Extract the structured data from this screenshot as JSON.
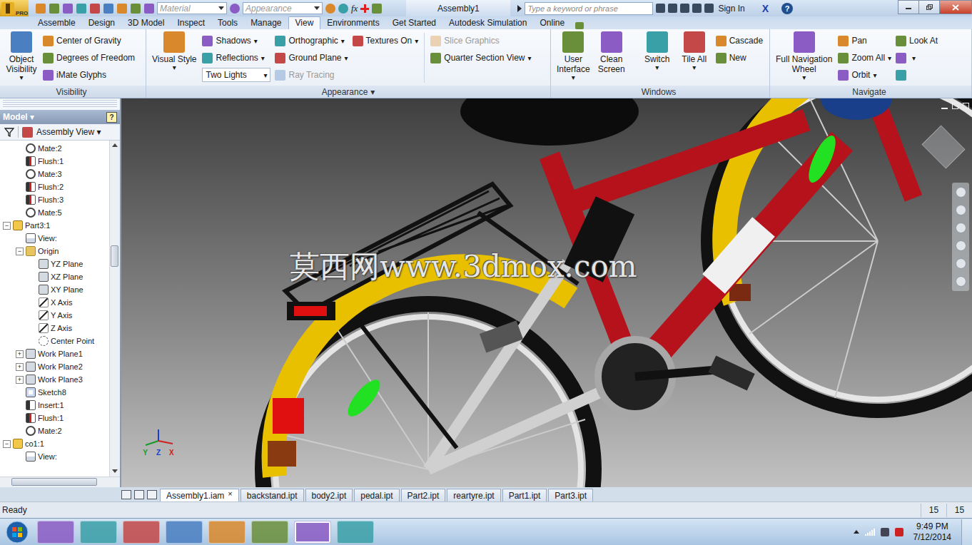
{
  "title_bar": {
    "app_badge": "PRO",
    "material": "Material",
    "appearance": "Appearance",
    "formula": "fx",
    "title": "Assembly1",
    "search_placeholder": "Type a keyword or phrase",
    "sign_in": "Sign In",
    "exchange": "X",
    "help": "?"
  },
  "menu_tabs": [
    {
      "label": "Assemble",
      "selected": false
    },
    {
      "label": "Design",
      "selected": false
    },
    {
      "label": "3D Model",
      "selected": false
    },
    {
      "label": "Inspect",
      "selected": false
    },
    {
      "label": "Tools",
      "selected": false
    },
    {
      "label": "Manage",
      "selected": false
    },
    {
      "label": "View",
      "selected": true
    },
    {
      "label": "Environments",
      "selected": false
    },
    {
      "label": "Get Started",
      "selected": false
    },
    {
      "label": "Autodesk Simulation",
      "selected": false
    },
    {
      "label": "Online",
      "selected": false
    }
  ],
  "ribbon": {
    "groups": [
      {
        "label": "Visibility",
        "arrow": "",
        "columns": [
          {
            "kind": "large",
            "items": [
              {
                "lines": [
                  "Object",
                  "Visibility"
                ],
                "arrow": "▾",
                "disabled": false
              }
            ]
          },
          {
            "kind": "stack",
            "items": [
              {
                "kind": "button",
                "label": "Center of Gravity",
                "arrow": "",
                "disabled": false
              },
              {
                "kind": "button",
                "label": "Degrees of Freedom",
                "arrow": "",
                "disabled": false
              },
              {
                "kind": "button",
                "label": "iMate Glyphs",
                "arrow": "",
                "disabled": false
              }
            ]
          }
        ]
      },
      {
        "label": "Appearance",
        "arrow": "▾",
        "columns": [
          {
            "kind": "large",
            "items": [
              {
                "lines": [
                  "Visual Style"
                ],
                "arrow": "▾",
                "disabled": false
              }
            ]
          },
          {
            "kind": "stack",
            "items": [
              {
                "kind": "button",
                "label": "Shadows",
                "arrow": "▾",
                "disabled": false
              },
              {
                "kind": "button",
                "label": "Reflections",
                "arrow": "▾",
                "disabled": false
              },
              {
                "kind": "combo",
                "label": "Two Lights",
                "arrow": "▾",
                "disabled": false
              }
            ]
          },
          {
            "kind": "stack",
            "items": [
              {
                "kind": "button",
                "label": "Orthographic",
                "arrow": "▾",
                "disabled": false
              },
              {
                "kind": "button",
                "label": "Ground Plane",
                "arrow": "▾",
                "disabled": false
              },
              {
                "kind": "button",
                "label": "Ray Tracing",
                "arrow": "",
                "disabled": true
              }
            ]
          },
          {
            "kind": "stack",
            "items": [
              {
                "kind": "button",
                "label": "Textures On",
                "arrow": "▾",
                "disabled": false
              }
            ]
          },
          {
            "kind": "divider",
            "items": []
          },
          {
            "kind": "stack",
            "items": [
              {
                "kind": "button",
                "label": "Slice Graphics",
                "arrow": "",
                "disabled": true
              },
              {
                "kind": "button",
                "label": "Quarter Section View",
                "arrow": "▾",
                "disabled": false
              }
            ]
          }
        ]
      },
      {
        "label": "Windows",
        "arrow": "",
        "columns": [
          {
            "kind": "large",
            "items": [
              {
                "lines": [
                  "User",
                  "Interface"
                ],
                "arrow": "▾",
                "disabled": false
              },
              {
                "lines": [
                  "Clean",
                  "Screen"
                ],
                "arrow": "",
                "disabled": false
              }
            ]
          },
          {
            "kind": "divider",
            "items": []
          },
          {
            "kind": "large",
            "items": [
              {
                "lines": [
                  "Switch"
                ],
                "arrow": "▾",
                "disabled": false
              },
              {
                "lines": [
                  "Tile All"
                ],
                "arrow": "▾",
                "disabled": false
              }
            ]
          },
          {
            "kind": "stack",
            "items": [
              {
                "kind": "button",
                "label": "Cascade",
                "arrow": "",
                "disabled": false
              },
              {
                "kind": "button",
                "label": "New",
                "arrow": "",
                "disabled": false
              }
            ]
          }
        ]
      },
      {
        "label": "Navigate",
        "arrow": "",
        "columns": [
          {
            "kind": "large",
            "items": [
              {
                "lines": [
                  "Full Navigation",
                  "Wheel"
                ],
                "arrow": "▾",
                "disabled": false
              }
            ]
          },
          {
            "kind": "stack",
            "items": [
              {
                "kind": "button",
                "label": "Pan",
                "arrow": "",
                "disabled": false
              },
              {
                "kind": "button",
                "label": "Zoom All",
                "arrow": "▾",
                "disabled": false
              },
              {
                "kind": "button",
                "label": "Orbit",
                "arrow": "▾",
                "disabled": false
              }
            ]
          },
          {
            "kind": "stack",
            "items": [
              {
                "kind": "button",
                "label": "Look At",
                "arrow": "",
                "disabled": false
              },
              {
                "kind": "button",
                "label": "",
                "arrow": "▾",
                "disabled": false
              },
              {
                "kind": "button",
                "label": "",
                "arrow": "",
                "disabled": false
              }
            ]
          }
        ]
      }
    ]
  },
  "browser": {
    "title": "Model",
    "title_arrow": "▾",
    "help": "?",
    "filter": "Assembly View",
    "filter_arrow": "▾",
    "toggle_glyphs": {
      "expanded": "−",
      "collapsed": "+"
    },
    "scroll": {
      "level": 0.3
    },
    "tree": [
      {
        "label": "Mate:2",
        "level": 2,
        "kind": "mate",
        "has_children": false,
        "expanded": false
      },
      {
        "label": "Flush:1",
        "level": 2,
        "kind": "flush",
        "has_children": false,
        "expanded": false
      },
      {
        "label": "Mate:3",
        "level": 2,
        "kind": "mate",
        "has_children": false,
        "expanded": false
      },
      {
        "label": "Flush:2",
        "level": 2,
        "kind": "flush",
        "has_children": false,
        "expanded": false
      },
      {
        "label": "Flush:3",
        "level": 2,
        "kind": "flush",
        "has_children": false,
        "expanded": false
      },
      {
        "label": "Mate:5",
        "level": 2,
        "kind": "mate",
        "has_children": false,
        "expanded": false
      },
      {
        "label": "Part3:1",
        "level": 1,
        "kind": "part",
        "has_children": true,
        "expanded": true
      },
      {
        "label": "View:",
        "level": 2,
        "kind": "view",
        "has_children": false,
        "expanded": false
      },
      {
        "label": "Origin",
        "level": 2,
        "kind": "folder",
        "has_children": true,
        "expanded": true
      },
      {
        "label": "YZ Plane",
        "level": 3,
        "kind": "plane",
        "has_children": false,
        "expanded": false
      },
      {
        "label": "XZ Plane",
        "level": 3,
        "kind": "plane",
        "has_children": false,
        "expanded": false
      },
      {
        "label": "XY Plane",
        "level": 3,
        "kind": "plane",
        "has_children": false,
        "expanded": false
      },
      {
        "label": "X Axis",
        "level": 3,
        "kind": "axis",
        "has_children": false,
        "expanded": false
      },
      {
        "label": "Y Axis",
        "level": 3,
        "kind": "axis",
        "has_children": false,
        "expanded": false
      },
      {
        "label": "Z Axis",
        "level": 3,
        "kind": "axis",
        "has_children": false,
        "expanded": false
      },
      {
        "label": "Center Point",
        "level": 3,
        "kind": "point",
        "has_children": false,
        "expanded": false
      },
      {
        "label": "Work Plane1",
        "level": 2,
        "kind": "plane",
        "has_children": true,
        "expanded": false
      },
      {
        "label": "Work Plane2",
        "level": 2,
        "kind": "plane",
        "has_children": true,
        "expanded": false
      },
      {
        "label": "Work Plane3",
        "level": 2,
        "kind": "plane",
        "has_children": true,
        "expanded": false
      },
      {
        "label": "Sketch8",
        "level": 2,
        "kind": "sketch",
        "has_children": false,
        "expanded": false
      },
      {
        "label": "Insert:1",
        "level": 2,
        "kind": "insert",
        "has_children": false,
        "expanded": false
      },
      {
        "label": "Flush:1",
        "level": 2,
        "kind": "flush",
        "has_children": false,
        "expanded": false
      },
      {
        "label": "Mate:2",
        "level": 2,
        "kind": "mate",
        "has_children": false,
        "expanded": false
      },
      {
        "label": "co1:1",
        "level": 1,
        "kind": "part",
        "has_children": true,
        "expanded": true
      },
      {
        "label": "View:",
        "level": 2,
        "kind": "view",
        "has_children": false,
        "expanded": false
      }
    ]
  },
  "viewport": {
    "watermark": "莫西网www.3dmox.com",
    "axis_labels": [
      {
        "label": "Y",
        "color": "#1a9a2a"
      },
      {
        "label": "Z",
        "color": "#1a3fd0"
      },
      {
        "label": "X",
        "color": "#d02020"
      }
    ]
  },
  "doc_tabs": {
    "close_glyph": "×",
    "tabs": [
      {
        "label": "Assembly1.iam",
        "selected": true
      },
      {
        "label": "backstand.ipt",
        "selected": false
      },
      {
        "label": "body2.ipt",
        "selected": false
      },
      {
        "label": "pedal.ipt",
        "selected": false
      },
      {
        "label": "Part2.ipt",
        "selected": false
      },
      {
        "label": "reartyre.ipt",
        "selected": false
      },
      {
        "label": "Part1.ipt",
        "selected": false
      },
      {
        "label": "Part3.ipt",
        "selected": false
      }
    ]
  },
  "status_bar": {
    "text": "Ready",
    "counts": [
      "15",
      "15"
    ]
  },
  "taskbar": {
    "time": "9:49 PM",
    "date": "7/12/2014"
  }
}
